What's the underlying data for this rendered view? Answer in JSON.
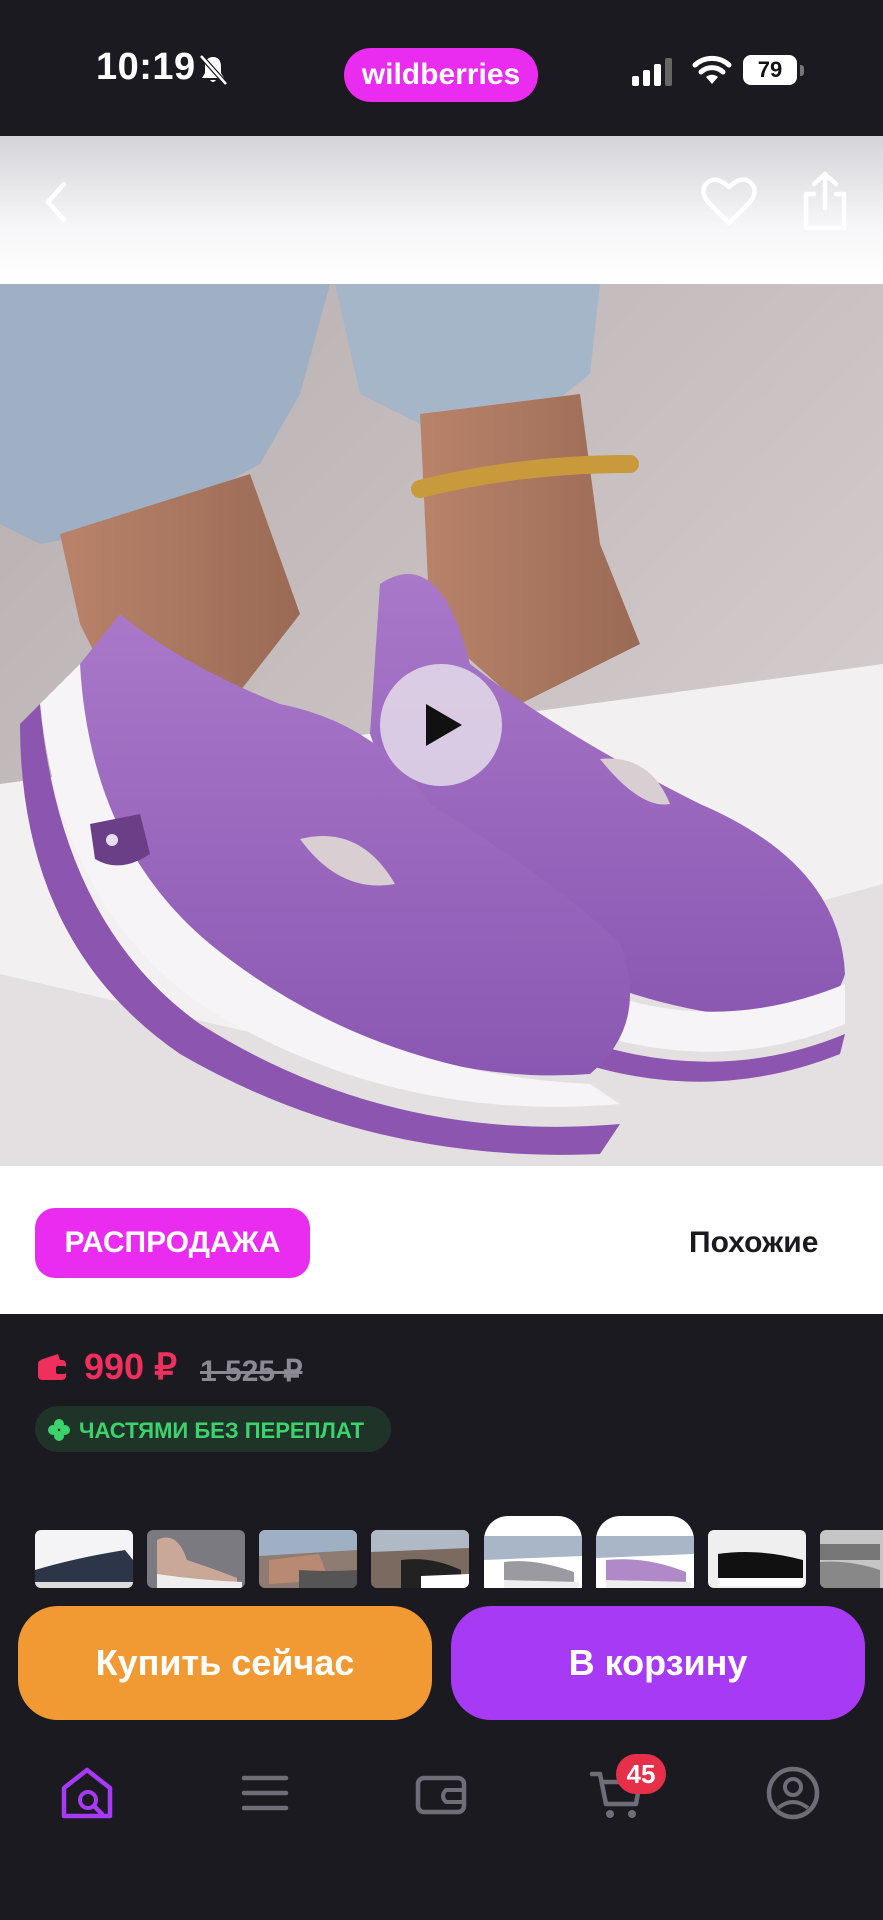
{
  "status_bar": {
    "time": "10:19",
    "brand": "wildberries",
    "battery": "79",
    "icons": [
      "bell-muted-icon",
      "signal-icon",
      "wifi-icon",
      "battery-icon"
    ]
  },
  "header": {
    "icons": [
      "back-icon",
      "heart-icon",
      "share-icon"
    ]
  },
  "media": {
    "icons": [
      "play-icon"
    ]
  },
  "promo": {
    "sale_label": "РАСПРОДАЖА",
    "similar_label": "Похожие"
  },
  "price": {
    "current": "990 ₽",
    "old": "1 525 ₽",
    "installments_label": "ЧАСТЯМИ БЕЗ ПЕРЕПЛАТ"
  },
  "thumbnails": [
    {
      "name": "thumb-1",
      "selected": false
    },
    {
      "name": "thumb-2",
      "selected": false
    },
    {
      "name": "thumb-3",
      "selected": false
    },
    {
      "name": "thumb-4",
      "selected": false
    },
    {
      "name": "thumb-5",
      "selected": true
    },
    {
      "name": "thumb-6",
      "selected": true
    },
    {
      "name": "thumb-7",
      "selected": false
    },
    {
      "name": "thumb-8",
      "selected": false
    }
  ],
  "actions": {
    "buy_now": "Купить сейчас",
    "add_to_cart": "В корзину"
  },
  "bottom_nav": {
    "items": [
      "home-search-icon",
      "catalog-icon",
      "wallet-icon",
      "cart-icon",
      "profile-icon"
    ],
    "cart_count": "45"
  },
  "colors": {
    "brand": "#ea2cf0",
    "price": "#f0305c",
    "installments_text": "#3bd46c",
    "buy_now": "#f19a33",
    "add_to_cart": "#a73af5",
    "nav_active": "#a73af5",
    "dark_bg": "#1b1a21"
  }
}
